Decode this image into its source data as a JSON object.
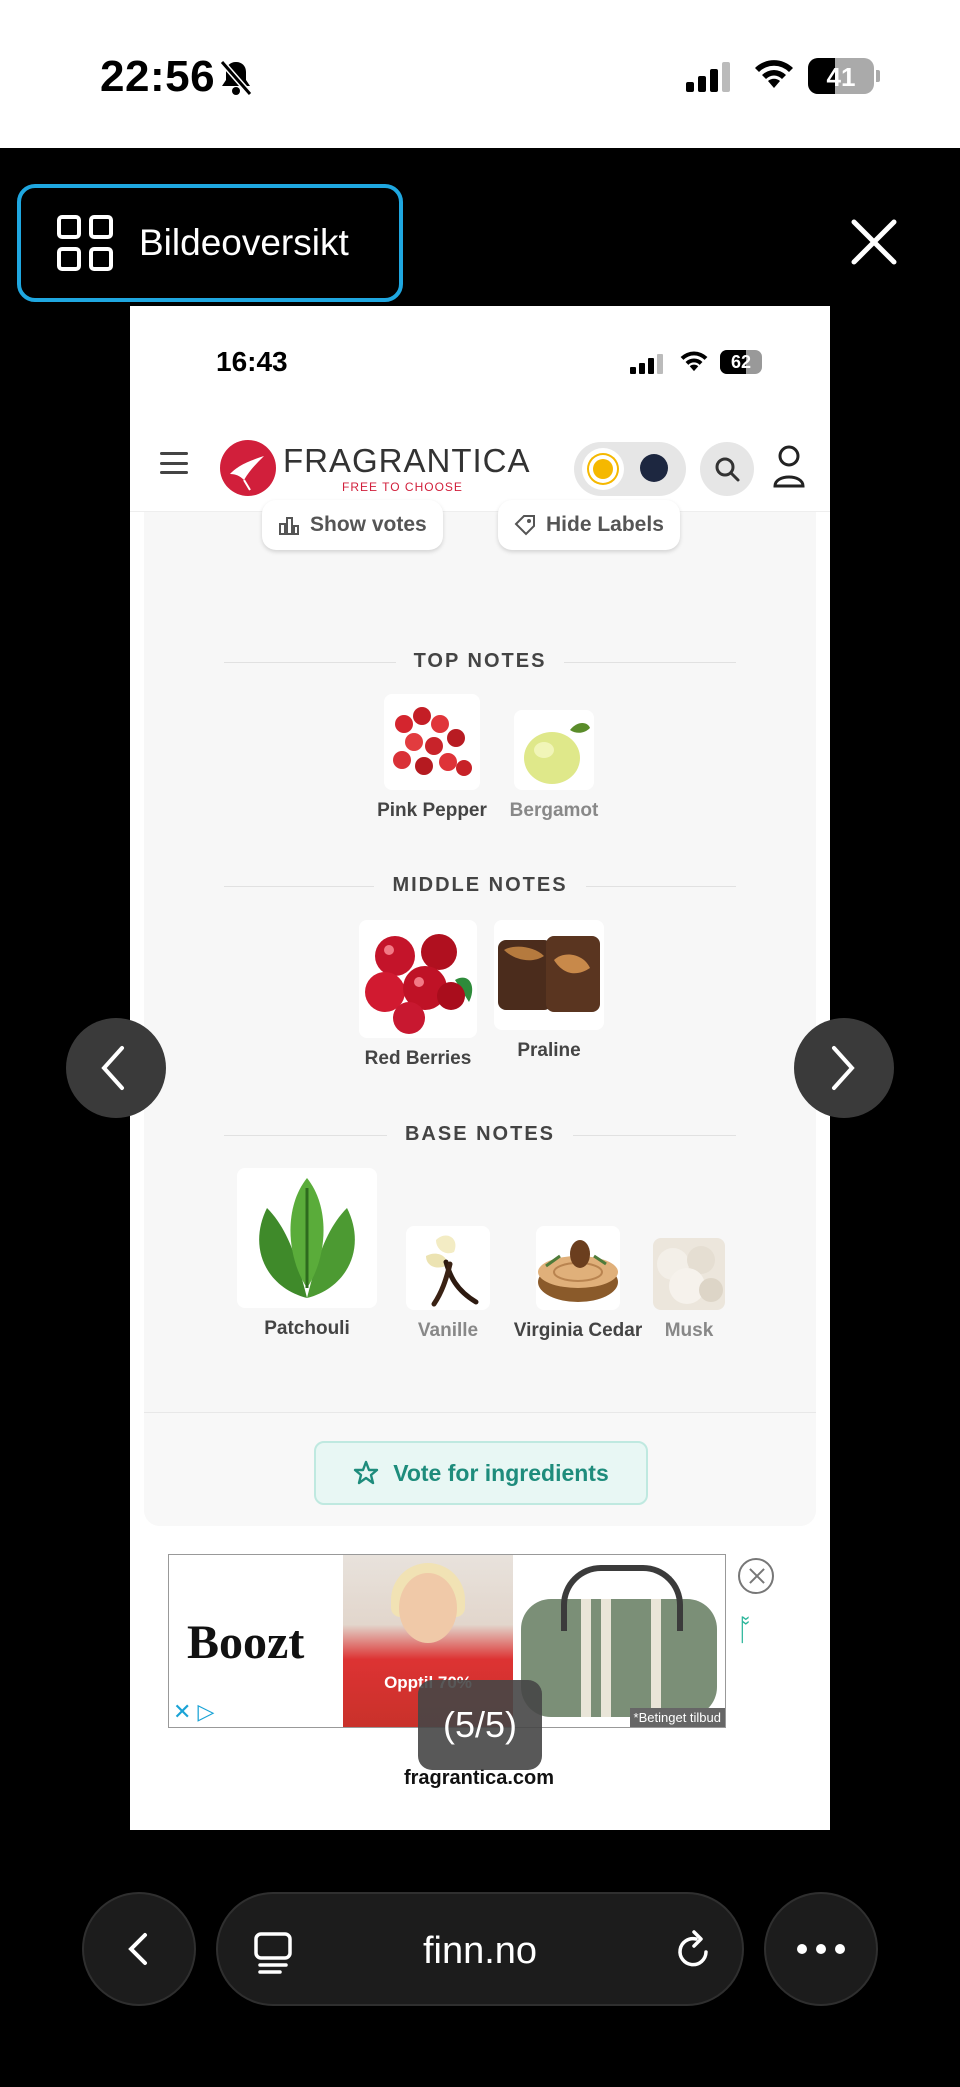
{
  "status_bar": {
    "time": "22:56",
    "battery": "41",
    "battery_level": 0.41
  },
  "overlay": {
    "gallery_label": "Bildeoversikt",
    "counter": "(5/5)",
    "domain": "fragrantica.com"
  },
  "inner_status": {
    "time": "16:43",
    "battery": "62",
    "battery_level": 0.62
  },
  "site": {
    "logo_name": "FRAGRANTICA",
    "logo_tagline": "FREE TO CHOOSE",
    "show_votes": "Show votes",
    "hide_labels": "Hide Labels"
  },
  "pyramid": {
    "top": {
      "title": "TOP NOTES",
      "notes": [
        {
          "name": "Pink Pepper"
        },
        {
          "name": "Bergamot"
        }
      ]
    },
    "middle": {
      "title": "MIDDLE NOTES",
      "notes": [
        {
          "name": "Red Berries"
        },
        {
          "name": "Praline"
        }
      ]
    },
    "base": {
      "title": "BASE NOTES",
      "notes": [
        {
          "name": "Patchouli"
        },
        {
          "name": "Vanille"
        },
        {
          "name": "Virginia Cedar"
        },
        {
          "name": "Musk"
        }
      ]
    }
  },
  "vote_button": "Vote for ingredients",
  "ad": {
    "brand": "Boozt",
    "promo": "Opptil 70%",
    "terms": "*Betinget tilbud"
  },
  "browser": {
    "url": "finn.no"
  },
  "colors": {
    "accent": "#1fa7e0",
    "brand_red": "#d11f3b",
    "teal": "#1e8c7c"
  }
}
